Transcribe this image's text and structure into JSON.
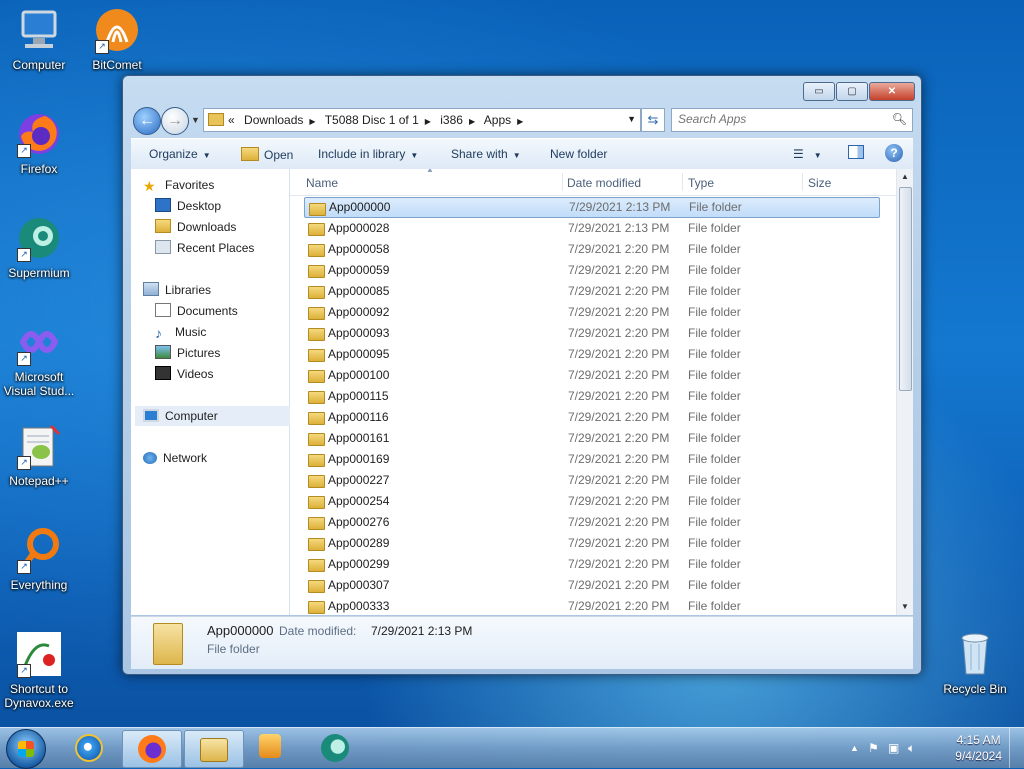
{
  "desktop": {
    "icons": [
      {
        "label": "Computer",
        "icon": "computer-icon"
      },
      {
        "label": "BitComet",
        "icon": "bitcomet-icon"
      },
      {
        "label": "Firefox",
        "icon": "firefox-icon"
      },
      {
        "label": "Supermium",
        "icon": "supermium-icon"
      },
      {
        "label": "Microsoft Visual Stud...",
        "icon": "visual-studio-icon"
      },
      {
        "label": "Notepad++",
        "icon": "notepadpp-icon"
      },
      {
        "label": "Everything",
        "icon": "everything-icon"
      },
      {
        "label": "Shortcut to Dynavox.exe",
        "icon": "dynavox-icon"
      },
      {
        "label": "Recycle Bin",
        "icon": "recycle-bin-icon"
      }
    ]
  },
  "window": {
    "caption_buttons": {
      "minimize": "▭",
      "maximize": "▢",
      "close": "✕"
    },
    "address": {
      "overflow": "«",
      "crumbs": [
        "Downloads",
        "T5088 Disc 1 of 1",
        "i386",
        "Apps"
      ]
    },
    "search": {
      "placeholder": "Search Apps"
    },
    "toolbar": {
      "organize": "Organize",
      "open": "Open",
      "include": "Include in library",
      "share": "Share with",
      "new_folder": "New folder"
    },
    "nav": {
      "favorites": "Favorites",
      "desktop": "Desktop",
      "downloads": "Downloads",
      "recent": "Recent Places",
      "libraries": "Libraries",
      "documents": "Documents",
      "music": "Music",
      "pictures": "Pictures",
      "videos": "Videos",
      "computer": "Computer",
      "network": "Network"
    },
    "columns": {
      "name": "Name",
      "date": "Date modified",
      "type": "Type",
      "size": "Size"
    },
    "files": [
      {
        "name": "App000000",
        "date": "7/29/2021 2:13 PM",
        "type": "File folder"
      },
      {
        "name": "App000028",
        "date": "7/29/2021 2:13 PM",
        "type": "File folder"
      },
      {
        "name": "App000058",
        "date": "7/29/2021 2:20 PM",
        "type": "File folder"
      },
      {
        "name": "App000059",
        "date": "7/29/2021 2:20 PM",
        "type": "File folder"
      },
      {
        "name": "App000085",
        "date": "7/29/2021 2:20 PM",
        "type": "File folder"
      },
      {
        "name": "App000092",
        "date": "7/29/2021 2:20 PM",
        "type": "File folder"
      },
      {
        "name": "App000093",
        "date": "7/29/2021 2:20 PM",
        "type": "File folder"
      },
      {
        "name": "App000095",
        "date": "7/29/2021 2:20 PM",
        "type": "File folder"
      },
      {
        "name": "App000100",
        "date": "7/29/2021 2:20 PM",
        "type": "File folder"
      },
      {
        "name": "App000115",
        "date": "7/29/2021 2:20 PM",
        "type": "File folder"
      },
      {
        "name": "App000116",
        "date": "7/29/2021 2:20 PM",
        "type": "File folder"
      },
      {
        "name": "App000161",
        "date": "7/29/2021 2:20 PM",
        "type": "File folder"
      },
      {
        "name": "App000169",
        "date": "7/29/2021 2:20 PM",
        "type": "File folder"
      },
      {
        "name": "App000227",
        "date": "7/29/2021 2:20 PM",
        "type": "File folder"
      },
      {
        "name": "App000254",
        "date": "7/29/2021 2:20 PM",
        "type": "File folder"
      },
      {
        "name": "App000276",
        "date": "7/29/2021 2:20 PM",
        "type": "File folder"
      },
      {
        "name": "App000289",
        "date": "7/29/2021 2:20 PM",
        "type": "File folder"
      },
      {
        "name": "App000299",
        "date": "7/29/2021 2:20 PM",
        "type": "File folder"
      },
      {
        "name": "App000307",
        "date": "7/29/2021 2:20 PM",
        "type": "File folder"
      },
      {
        "name": "App000333",
        "date": "7/29/2021 2:20 PM",
        "type": "File folder"
      }
    ],
    "selected_index": 0,
    "details": {
      "name": "App000000",
      "date_label": "Date modified:",
      "date_value": "7/29/2021 2:13 PM",
      "type": "File folder"
    }
  },
  "taskbar": {
    "apps": [
      "ie-icon",
      "firefox-icon",
      "explorer-icon",
      "media-player-icon",
      "supermium-icon"
    ],
    "clock": {
      "time": "4:15 AM",
      "date": "9/4/2024"
    }
  },
  "colors": {
    "selection": "#c1dcfa",
    "accent": "#2d64b0"
  }
}
